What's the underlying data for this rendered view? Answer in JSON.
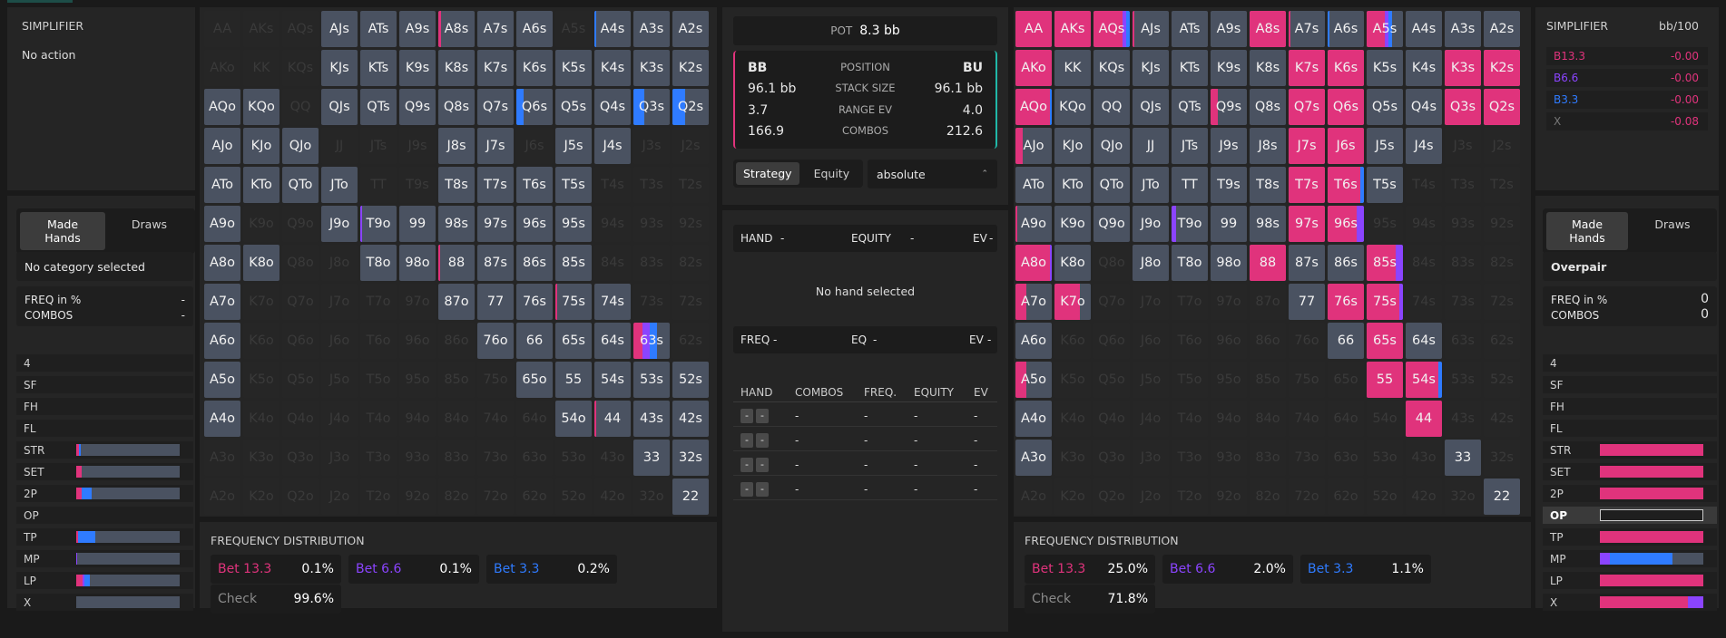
{
  "left_top": {
    "title": "SIMPLIFIER",
    "action": "No action"
  },
  "left_cat": {
    "tabs": [
      "Made Hands",
      "Draws"
    ],
    "selected": "No category selected",
    "freq_label": "FREQ in %",
    "freq_value": "-",
    "combos_label": "COMBOS",
    "combos_value": "-"
  },
  "right_top": {
    "title": "SIMPLIFIER",
    "unit": "bb/100",
    "rows": [
      {
        "label": "B13.3",
        "value": "-0.00",
        "color": "#e0337c"
      },
      {
        "label": "B6.6",
        "value": "-0.00",
        "color": "#8b44ff"
      },
      {
        "label": "B3.3",
        "value": "-0.00",
        "color": "#2f7bff"
      },
      {
        "label": "X",
        "value": "-0.08",
        "color": "#777777"
      }
    ]
  },
  "right_cat": {
    "tabs": [
      "Made Hands",
      "Draws"
    ],
    "selected": "Overpair",
    "freq_label": "FREQ in %",
    "freq_value": "0",
    "combos_label": "COMBOS",
    "combos_value": "0"
  },
  "categories": [
    "4",
    "SF",
    "FH",
    "FL",
    "STR",
    "SET",
    "2P",
    "OP",
    "TP",
    "MP",
    "LP",
    "X"
  ],
  "left_bars": [
    null,
    null,
    null,
    null,
    [
      [
        0,
        0.03,
        "#e0337c"
      ],
      [
        0.03,
        0.01,
        "#2f7bff"
      ]
    ],
    [
      [
        0,
        0.05,
        "#e0337c"
      ]
    ],
    [
      [
        0,
        0.05,
        "#e0337c"
      ],
      [
        0.05,
        0.05,
        "#8b44ff"
      ],
      [
        0.05,
        0.1,
        "#2f7bff"
      ]
    ],
    null,
    [
      [
        0,
        0.02,
        "#e0337c"
      ],
      [
        0.02,
        0.16,
        "#2f7bff"
      ]
    ],
    [
      [
        0,
        0.01,
        "#8b44ff"
      ]
    ],
    [
      [
        0,
        0.06,
        "#e0337c"
      ],
      [
        0.06,
        0.02,
        "#8b44ff"
      ],
      [
        0.08,
        0.05,
        "#2f7bff"
      ]
    ],
    [
      [
        0,
        0,
        "#777"
      ]
    ]
  ],
  "right_bars": [
    null,
    null,
    null,
    null,
    [
      [
        0,
        1,
        "#e0337c"
      ]
    ],
    [
      [
        0,
        1,
        "#e0337c"
      ]
    ],
    [
      [
        0,
        1,
        "#e0337c"
      ]
    ],
    "op",
    [
      [
        0,
        1,
        "#e0337c"
      ]
    ],
    [
      [
        0,
        0.1,
        "#8b44ff"
      ],
      [
        0.1,
        0.6,
        "#2f7bff"
      ]
    ],
    [
      [
        0,
        1,
        "#e0337c"
      ]
    ],
    [
      [
        0,
        0.85,
        "#e0337c"
      ],
      [
        0.85,
        0.15,
        "#8b44ff"
      ]
    ]
  ],
  "ranks": [
    "A",
    "K",
    "Q",
    "J",
    "T",
    "9",
    "8",
    "7",
    "6",
    "5",
    "4",
    "3",
    "2"
  ],
  "left_grid_active": "AJs ATs A9s A8s A7s A6s A4s A3s A2s KJs KTs K9s K8s K7s K6s K5s K4s K3s K2s AQo KQo QJs QTs Q9s Q8s Q7s Q6s Q5s Q4s Q3s Q2s AJo KJo QJo J8s J7s J5s J4s ATo KTo QTo JTo T8s T7s T6s T5s A9o J9o T9o 99 98s 97s 96s 95s A8o K8o T8o 98o 88 87s 86s 85s A7o 87o 77 76s 75s 74s A6o 76o 66 65s 64s 63s A5o 65o 55 54s 53s 52s A4o 54o 44 43s 42s 33 32s 22",
  "left_grid_strips": {
    "A8s": [
      [
        "#e0337c",
        0.08
      ]
    ],
    "A4s": [
      [
        "#2f7bff",
        0.05
      ]
    ],
    "Q6s": [
      [
        "#2f7bff",
        0.2
      ]
    ],
    "Q3s": [
      [
        "#2f7bff",
        0.3
      ]
    ],
    "Q2s": [
      [
        "#2f7bff",
        0.35
      ]
    ],
    "88": [
      [
        "#e0337c",
        0.05
      ]
    ],
    "75s": [
      [
        "#e0337c",
        0.05
      ]
    ],
    "44": [
      [
        "#e0337c",
        0.05
      ]
    ],
    "63s": [
      [
        "#e0337c",
        0.25
      ],
      [
        "#8b44ff",
        0.2
      ],
      [
        "#2f7bff",
        0.2
      ]
    ],
    "T9o": [
      [
        "#8b44ff",
        0.05
      ]
    ]
  },
  "right_grid_active": "AA AKs AQs AJs ATs A9s A8s A7s A6s A5s A4s A3s A2s AKo KK KQs KJs KTs K9s K8s K7s K6s K5s K4s K3s K2s AQo KQo QQ QJs QTs Q9s Q8s Q7s Q6s Q5s Q4s Q3s Q2s AJo KJo QJo JJ JTs J9s J8s J7s J6s J5s J4s ATo KTo QTo JTo TT T9s T8s T7s T6s T5s A9o K9o Q9o J9o T9o 99 98s 97s 96s A8o K8o J8o T8o 98o 88 87s 86s 85s A7o K7o 77 76s 75s A6o 66 65s 64s A5o 55 54s 44 33 22 A4o A3o",
  "right_grid_strips": {
    "AA": [
      [
        "#e0337c",
        1
      ]
    ],
    "AKs": [
      [
        "#e0337c",
        1
      ]
    ],
    "AQs": [
      [
        "#e0337c",
        0.8
      ],
      [
        "#8b44ff",
        0.1
      ],
      [
        "#2f7bff",
        0.1
      ]
    ],
    "AJs": [
      [
        "#e0337c",
        0.05
      ]
    ],
    "A8s": [
      [
        "#e0337c",
        1
      ]
    ],
    "A7s": [
      [
        "#e0337c",
        0.05
      ]
    ],
    "A6s": [
      [
        "#2f7bff",
        0.05
      ]
    ],
    "A5s": [
      [
        "#e0337c",
        0.5
      ],
      [
        "#8b44ff",
        0.1
      ],
      [
        "#2f7bff",
        0.1
      ]
    ],
    "AKo": [
      [
        "#e0337c",
        1
      ]
    ],
    "K7s": [
      [
        "#e0337c",
        1
      ]
    ],
    "K6s": [
      [
        "#e0337c",
        1
      ]
    ],
    "K3s": [
      [
        "#e0337c",
        1
      ]
    ],
    "K2s": [
      [
        "#e0337c",
        1
      ]
    ],
    "AQo": [
      [
        "#e0337c",
        0.95
      ],
      [
        "#2f7bff",
        0.05
      ]
    ],
    "Q9s": [
      [
        "#e0337c",
        0.2
      ]
    ],
    "Q7s": [
      [
        "#e0337c",
        1
      ]
    ],
    "Q6s": [
      [
        "#e0337c",
        1
      ]
    ],
    "Q3s": [
      [
        "#e0337c",
        1
      ]
    ],
    "Q2s": [
      [
        "#e0337c",
        1
      ]
    ],
    "AJo": [
      [
        "#e0337c",
        0.2
      ]
    ],
    "J7s": [
      [
        "#e0337c",
        1
      ]
    ],
    "J6s": [
      [
        "#e0337c",
        1
      ]
    ],
    "T7s": [
      [
        "#e0337c",
        1
      ]
    ],
    "T6s": [
      [
        "#e0337c",
        0.9
      ],
      [
        "#2f7bff",
        0.1
      ]
    ],
    "A9o": [
      [
        "#e0337c",
        0.05
      ]
    ],
    "T9o": [
      [
        "#8b44ff",
        0.12
      ]
    ],
    "97s": [
      [
        "#e0337c",
        1
      ]
    ],
    "96s": [
      [
        "#e0337c",
        0.8
      ],
      [
        "#8b44ff",
        0.2
      ]
    ],
    "A8o": [
      [
        "#e0337c",
        0.95
      ],
      [
        "#8b44ff",
        0.05
      ]
    ],
    "88": [
      [
        "#e0337c",
        1
      ]
    ],
    "85s": [
      [
        "#e0337c",
        0.8
      ],
      [
        "#8b44ff",
        0.2
      ]
    ],
    "A7o": [
      [
        "#e0337c",
        0.3
      ]
    ],
    "K7o": [
      [
        "#e0337c",
        0.7
      ]
    ],
    "76s": [
      [
        "#e0337c",
        1
      ]
    ],
    "75s": [
      [
        "#e0337c",
        0.9
      ],
      [
        "#8b44ff",
        0.1
      ]
    ],
    "65s": [
      [
        "#e0337c",
        1
      ]
    ],
    "A5o": [
      [
        "#e0337c",
        0.3
      ]
    ],
    "55": [
      [
        "#e0337c",
        1
      ]
    ],
    "54s": [
      [
        "#e0337c",
        0.9
      ],
      [
        "#2f7bff",
        0.1
      ]
    ],
    "44": [
      [
        "#e0337c",
        1
      ]
    ]
  },
  "center": {
    "pot_label": "POT",
    "pot_value": "8.3 bb",
    "left_pos": "BB",
    "right_pos": "BU",
    "pos_label": "POSITION",
    "left_stack": "96.1 bb",
    "stack_label": "STACK SIZE",
    "right_stack": "96.1 bb",
    "left_ev": "3.7",
    "ev_label": "RANGE EV",
    "right_ev": "4.0",
    "left_combos": "166.9",
    "combos_label": "COMBOS",
    "right_combos": "212.6",
    "tabs": [
      "Strategy",
      "Equity"
    ],
    "select": "absolute",
    "hand_label": "HAND",
    "hand_val": "-",
    "equity_label": "EQUITY",
    "equity_val": "-",
    "ev_hdr": "EV",
    "ev_val": "-",
    "no_hand": "No hand selected",
    "freq_label": "FREQ",
    "freq_val": "-",
    "eq_label": "EQ",
    "eq_val": "-",
    "ev2_label": "EV",
    "ev2_val": "-",
    "table_headers": [
      "HAND",
      "COMBOS",
      "FREQ.",
      "EQUITY",
      "EV"
    ],
    "table_rows": [
      [
        "-",
        "-",
        "-",
        "-",
        "-"
      ],
      [
        "-",
        "-",
        "-",
        "-",
        "-"
      ],
      [
        "-",
        "-",
        "-",
        "-",
        "-"
      ],
      [
        "-",
        "-",
        "-",
        "-",
        "-"
      ]
    ]
  },
  "left_freq": {
    "title": "FREQUENCY DISTRIBUTION",
    "items": [
      {
        "label": "Bet 13.3",
        "value": "0.1%",
        "color": "#e0337c"
      },
      {
        "label": "Bet 6.6",
        "value": "0.1%",
        "color": "#8b44ff"
      },
      {
        "label": "Bet 3.3",
        "value": "0.2%",
        "color": "#2f7bff"
      },
      {
        "label": "Check",
        "value": "99.6%",
        "color": "#8a8a8a"
      }
    ]
  },
  "right_freq": {
    "title": "FREQUENCY DISTRIBUTION",
    "items": [
      {
        "label": "Bet 13.3",
        "value": "25.0%",
        "color": "#e0337c"
      },
      {
        "label": "Bet 6.6",
        "value": "2.0%",
        "color": "#8b44ff"
      },
      {
        "label": "Bet 3.3",
        "value": "1.1%",
        "color": "#2f7bff"
      },
      {
        "label": "Check",
        "value": "71.8%",
        "color": "#8a8a8a"
      }
    ]
  }
}
